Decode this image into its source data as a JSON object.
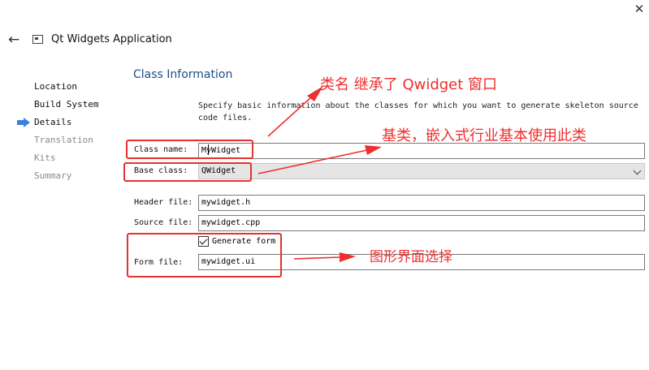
{
  "window": {
    "title": "Qt Widgets Application",
    "back_icon": "arrow-left-icon",
    "close_icon": "close-icon",
    "close_glyph": "✕",
    "back_glyph": "←"
  },
  "wizard_steps": [
    {
      "label": "Location",
      "state": "done"
    },
    {
      "label": "Build System",
      "state": "done"
    },
    {
      "label": "Details",
      "state": "current"
    },
    {
      "label": "Translation",
      "state": "pending"
    },
    {
      "label": "Kits",
      "state": "pending"
    },
    {
      "label": "Summary",
      "state": "pending"
    }
  ],
  "page": {
    "title": "Class Information",
    "description": "Specify basic information about the classes for which you want to generate skeleton source code files."
  },
  "form": {
    "class_name": {
      "label": "Class name:",
      "value": "MyWidget"
    },
    "base_class": {
      "label": "Base class:",
      "value": "QWidget"
    },
    "header_file": {
      "label": "Header file:",
      "value": "mywidget.h"
    },
    "source_file": {
      "label": "Source file:",
      "value": "mywidget.cpp"
    },
    "generate_form": {
      "label": "Generate form",
      "checked": true
    },
    "form_file": {
      "label": "Form file:",
      "value": "mywidget.ui"
    }
  },
  "annotations": {
    "class_note": "类名 继承了  Qwidget 窗口",
    "base_note": "基类，嵌入式行业基本使用此类",
    "form_note": "图形界面选择"
  },
  "colors": {
    "accent_title": "#1c4e86",
    "annotation_red": "#f02e2e",
    "step_arrow_blue": "#3d7fe0"
  }
}
